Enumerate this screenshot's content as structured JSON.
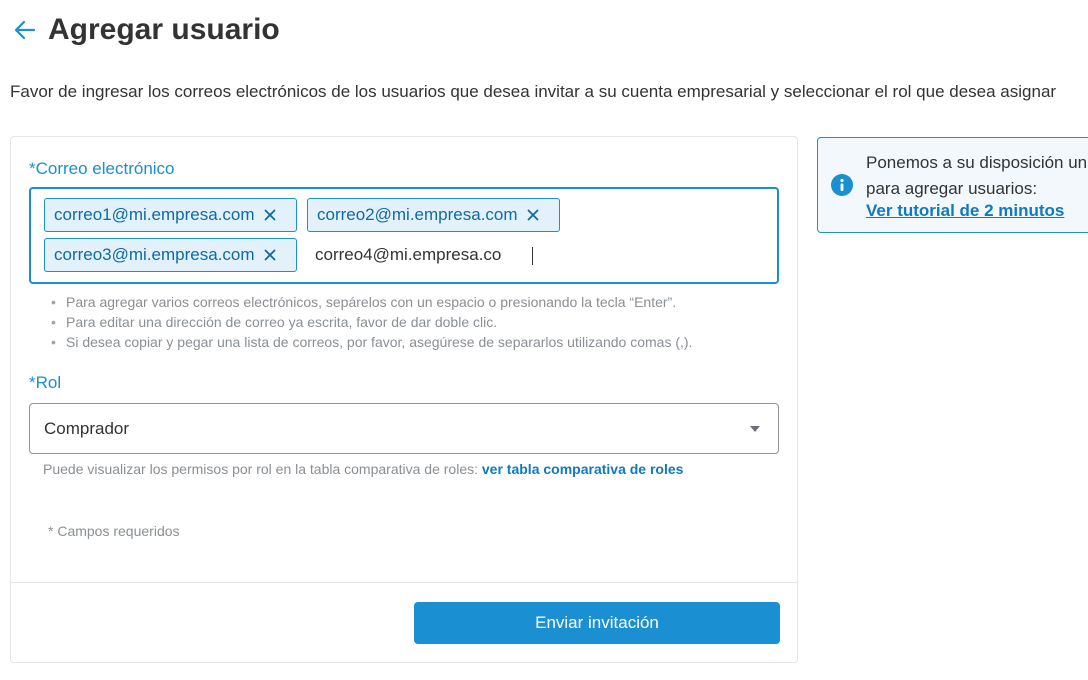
{
  "header": {
    "title": "Agregar usuario",
    "back_icon": "arrow-left-icon"
  },
  "description": "Favor de ingresar los correos electrónicos de los usuarios que desea invitar a su cuenta empresarial y seleccionar el rol que desea asignar",
  "form": {
    "email": {
      "label": "*Correo electrónico",
      "chips": [
        "correo1@mi.empresa.com",
        "correo2@mi.empresa.com",
        "correo3@mi.empresa.com"
      ],
      "input_value": "correo4@mi.empresa.co",
      "remove_icon": "close-icon"
    },
    "hints": [
      "Para agregar varios correos electrónicos, sepárelos con un espacio o presionando la tecla “Enter”.",
      "Para editar una dirección de correo ya escrita, favor de dar doble clic.",
      "Si desea copiar y pegar una lista de correos, por favor, asegúrese de separarlos utilizando comas (,)."
    ],
    "rol": {
      "label": "*Rol",
      "selected": "Comprador",
      "arrow_icon": "caret-down-icon"
    },
    "roles_note": "Puede visualizar los permisos por rol en la tabla comparativa de roles: ",
    "roles_link": "ver tabla comparativa de roles",
    "required_note": "* Campos requeridos",
    "submit_label": "Enviar invitación"
  },
  "info_panel": {
    "icon": "info-icon",
    "line1": "Ponemos a su disposición un",
    "line2": "para agregar usuarios:",
    "link": "Ver tutorial de 2 minutos"
  },
  "colors": {
    "accent": "#1a8fd1",
    "chip_bg": "#e3f1fa",
    "link": "#0f7ac0",
    "muted_text": "#8a8f94"
  }
}
